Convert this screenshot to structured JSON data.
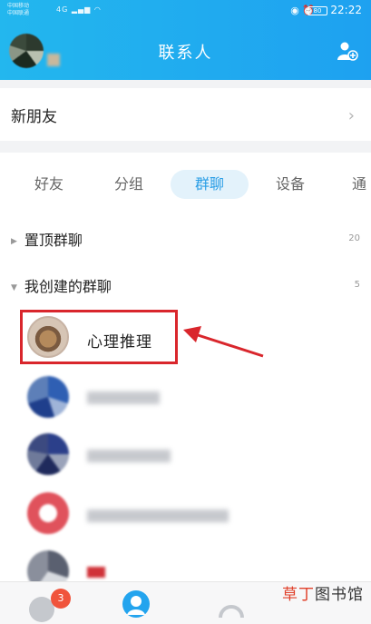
{
  "status_bar": {
    "carrier_1": "中国移动",
    "carrier_2": "中国联通",
    "net": "4G",
    "battery": "80",
    "time": "22:22"
  },
  "header": {
    "title": "联系人",
    "add_icon": "add-contact-icon"
  },
  "new_friends": {
    "label": "新朋友",
    "chevron": "›"
  },
  "tabs": [
    {
      "label": "好友"
    },
    {
      "label": "分组"
    },
    {
      "label": "群聊",
      "active": true
    },
    {
      "label": "设备"
    },
    {
      "label": "通"
    }
  ],
  "groups": {
    "pinned": {
      "label": "置顶群聊",
      "count": "20"
    },
    "created": {
      "label": "我创建的群聊",
      "count": "5"
    }
  },
  "chats": [
    {
      "name": "心理推理"
    }
  ],
  "bottom": {
    "badge": "3"
  },
  "watermark": {
    "part1": "草丁",
    "part2": "图书馆"
  },
  "colors": {
    "header": "#1ea1f0",
    "active_tab": "#2a9ee6",
    "highlight": "#d9262c",
    "badge": "#f0543c"
  }
}
